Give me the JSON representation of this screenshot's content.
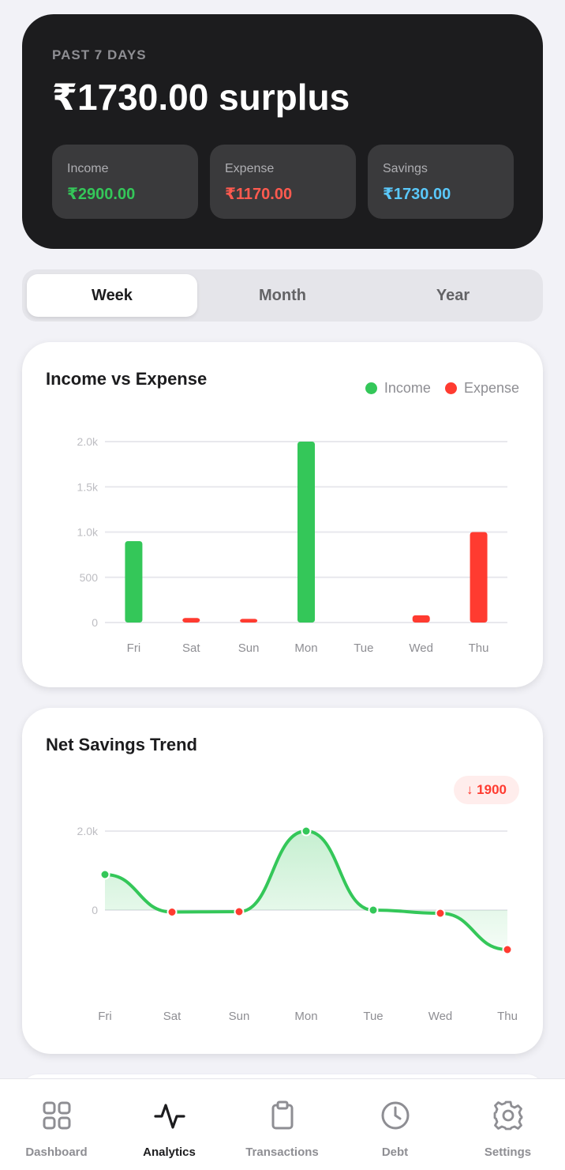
{
  "summary": {
    "period_label": "PAST 7 DAYS",
    "headline": "₹1730.00 surplus",
    "stats": [
      {
        "label": "Income",
        "value": "₹2900.00",
        "color": "#34C759"
      },
      {
        "label": "Expense",
        "value": "₹1170.00",
        "color": "#FF5A4F"
      },
      {
        "label": "Savings",
        "value": "₹1730.00",
        "color": "#5AC8FA"
      }
    ]
  },
  "segments": {
    "items": [
      "Week",
      "Month",
      "Year"
    ],
    "selected": "Week"
  },
  "income_expense": {
    "title": "Income vs Expense",
    "legend": [
      "Income",
      "Expense"
    ]
  },
  "net_trend": {
    "title": "Net Savings Trend",
    "badge": "↓ 1900"
  },
  "chart_data": [
    {
      "type": "bar",
      "title": "Income vs Expense",
      "categories": [
        "Fri",
        "Sat",
        "Sun",
        "Mon",
        "Tue",
        "Wed",
        "Thu"
      ],
      "series": [
        {
          "name": "Income",
          "color": "#34C759",
          "values": [
            900,
            0,
            0,
            2000,
            0,
            0,
            0
          ]
        },
        {
          "name": "Expense",
          "color": "#FF3B30",
          "values": [
            0,
            50,
            40,
            0,
            0,
            80,
            1000
          ]
        }
      ],
      "yticks": [
        0,
        500,
        1000,
        1500,
        2000
      ],
      "ytick_labels": [
        "0",
        "500",
        "1.0k",
        "1.5k",
        "2.0k"
      ],
      "ylim": [
        0,
        2000
      ],
      "grid": true,
      "legend_position": "top-right"
    },
    {
      "type": "area",
      "title": "Net Savings Trend",
      "categories": [
        "Fri",
        "Sat",
        "Sun",
        "Mon",
        "Tue",
        "Wed",
        "Thu"
      ],
      "values": [
        900,
        -50,
        -40,
        2000,
        0,
        -80,
        -1000
      ],
      "positive_color": "#34C759",
      "negative_color": "#FF3B30",
      "yticks": [
        0,
        2000
      ],
      "ytick_labels": [
        "0",
        "2.0k"
      ],
      "ylim": [
        -1000,
        2000
      ],
      "grid": true
    }
  ],
  "bottom_nav": {
    "items": [
      {
        "label": "Dashboard",
        "icon": "grid-icon"
      },
      {
        "label": "Analytics",
        "icon": "activity-icon"
      },
      {
        "label": "Transactions",
        "icon": "clipboard-icon"
      },
      {
        "label": "Debt",
        "icon": "clock-icon"
      },
      {
        "label": "Settings",
        "icon": "gear-icon"
      }
    ],
    "selected": "Analytics"
  }
}
